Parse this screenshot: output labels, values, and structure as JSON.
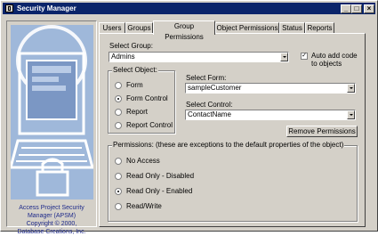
{
  "window": {
    "title": "Security Manager"
  },
  "title_buttons": {
    "minimize": "_",
    "maximize": "□",
    "close": "×"
  },
  "tabs": [
    {
      "label": "Users"
    },
    {
      "label": "Groups"
    },
    {
      "label": "Group Permissions"
    },
    {
      "label": "Object Permissions"
    },
    {
      "label": "Status"
    },
    {
      "label": "Reports"
    }
  ],
  "active_tab": "Group Permissions",
  "credits": {
    "line1": "Access Project Security",
    "line2": "Manager (APSM)",
    "line3": "Copyright © 2000,",
    "line4": "Database Creations, Inc."
  },
  "select_group": {
    "label": "Select Group:",
    "value": "Admins"
  },
  "auto_add": {
    "label_line1": "Auto add code",
    "label_line2": "to objects",
    "checked": true
  },
  "select_object": {
    "title": "Select Object:",
    "options": [
      "Form",
      "Form Control",
      "Report",
      "Report Control"
    ],
    "selected": "Form Control"
  },
  "select_form": {
    "label": "Select Form:",
    "value": "sampleCustomer"
  },
  "select_control": {
    "label": "Select Control:",
    "value": "ContactName"
  },
  "remove_button": {
    "label": "Remove Permissions"
  },
  "permissions": {
    "title": "Permissions: (these are exceptions to the default properties of the object)",
    "options": [
      "No Access",
      "Read Only - Disabled",
      "Read Only - Enabled",
      "Read/Write"
    ],
    "selected": "Read Only - Enabled"
  },
  "check_mark": "✓"
}
